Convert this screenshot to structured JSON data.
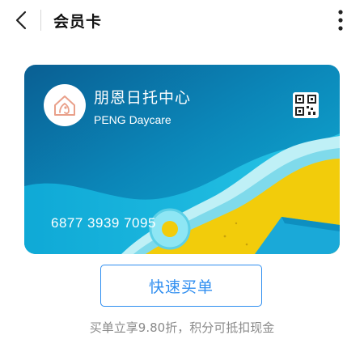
{
  "header": {
    "title": "会员卡"
  },
  "card": {
    "merchant_name": "朋恩日托中心",
    "merchant_name_en": "PENG Daycare",
    "number": "6877 3939 7095",
    "colors": {
      "ocean": "#0a6fa1",
      "sand": "#f2cc0b",
      "foam": "#8fe3f0"
    }
  },
  "actions": {
    "buy_label": "快速买单"
  },
  "promo": {
    "text": "买单立享9.80折，积分可抵扣现金"
  },
  "accent_color": "#2f8ef0"
}
